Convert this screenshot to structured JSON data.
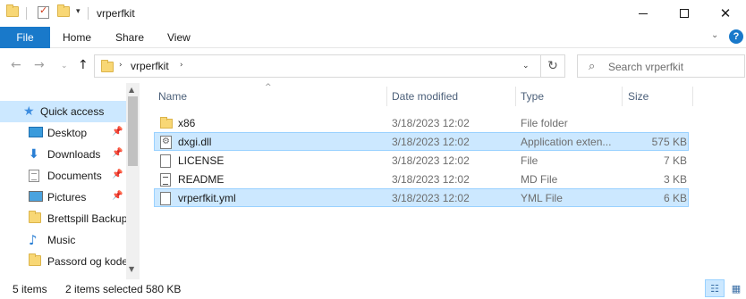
{
  "window": {
    "title": "vrperfkit",
    "qa_dropdown_glyph": "▾"
  },
  "ribbon": {
    "file_label": "File",
    "tabs": [
      "Home",
      "Share",
      "View"
    ],
    "expand_glyph": "⌄",
    "help_label": "?"
  },
  "nav": {
    "back_glyph": "←",
    "forward_glyph": "→",
    "recent_glyph": "⌄",
    "up_glyph": "↑",
    "breadcrumb_sep_1": "›",
    "breadcrumb_current": "vrperfkit",
    "breadcrumb_sep_2": "›",
    "dropdown_glyph": "⌄",
    "refresh_glyph": "↻"
  },
  "search": {
    "placeholder": "Search vrperfkit",
    "value": ""
  },
  "navpane": {
    "items": [
      {
        "label": "Quick access",
        "icon": "star-icon",
        "pinned": false
      },
      {
        "label": "Desktop",
        "icon": "desktop-icon",
        "pinned": true
      },
      {
        "label": "Downloads",
        "icon": "downloads-icon",
        "pinned": true
      },
      {
        "label": "Documents",
        "icon": "documents-icon",
        "pinned": true
      },
      {
        "label": "Pictures",
        "icon": "pictures-icon",
        "pinned": true
      },
      {
        "label": "Brettspill Backup",
        "icon": "folder-icon",
        "pinned": false
      },
      {
        "label": "Music",
        "icon": "music-icon",
        "pinned": false
      },
      {
        "label": "Passord og kode",
        "icon": "folder-icon",
        "pinned": false
      }
    ],
    "pin_glyph": "📌"
  },
  "columns": {
    "name": "Name",
    "date": "Date modified",
    "type": "Type",
    "size": "Size",
    "sort_glyph": "^"
  },
  "files": [
    {
      "name": "x86",
      "date": "3/18/2023 12:02",
      "type": "File folder",
      "size": "",
      "icon": "folder-icon",
      "selected": false
    },
    {
      "name": "dxgi.dll",
      "date": "3/18/2023 12:02",
      "type": "Application exten...",
      "size": "575 KB",
      "icon": "dll-file-icon",
      "selected": true
    },
    {
      "name": "LICENSE",
      "date": "3/18/2023 12:02",
      "type": "File",
      "size": "7 KB",
      "icon": "file-icon",
      "selected": false
    },
    {
      "name": "README",
      "date": "3/18/2023 12:02",
      "type": "MD File",
      "size": "3 KB",
      "icon": "md-file-icon",
      "selected": false
    },
    {
      "name": "vrperfkit.yml",
      "date": "3/18/2023 12:02",
      "type": "YML File",
      "size": "6 KB",
      "icon": "file-icon",
      "selected": true
    }
  ],
  "status": {
    "item_count": "5 items",
    "selection": "2 items selected",
    "selection_size": "580 KB",
    "details_view_glyph": "☷",
    "tiles_view_glyph": "▦"
  }
}
